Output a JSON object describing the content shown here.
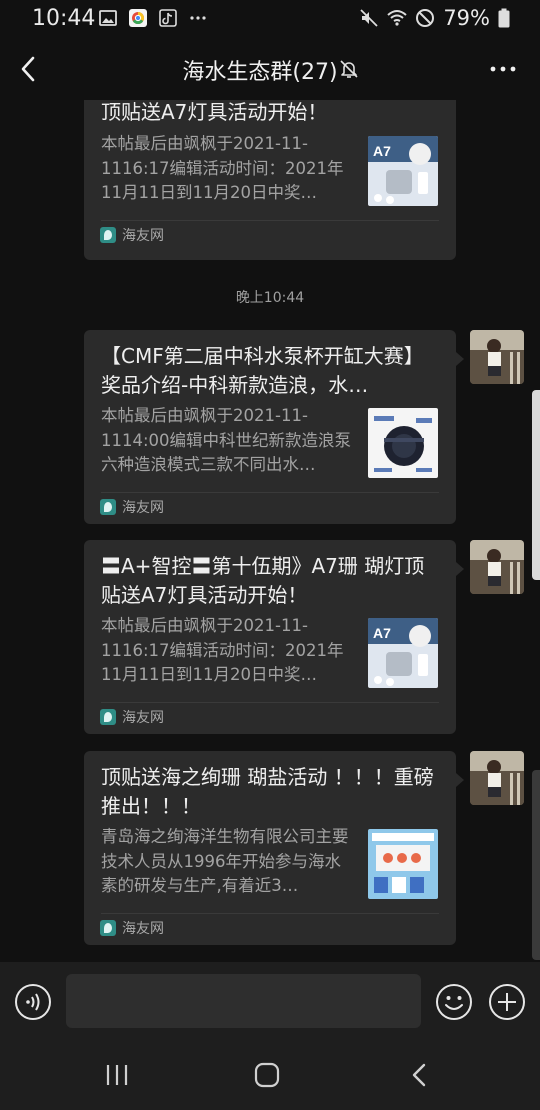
{
  "status_bar": {
    "time": "10:44",
    "battery": "79%",
    "left_icons": [
      "gallery-icon",
      "chrome-icon",
      "tiktok-icon",
      "more-dots-icon"
    ],
    "right_icons": [
      "mute-icon",
      "wifi-icon",
      "do-not-disturb-icon",
      "battery-icon"
    ]
  },
  "header": {
    "title": "海水生态群(27)",
    "mute_icon": "bell-off-icon"
  },
  "messages": [
    {
      "title": "顶贴送A7灯具活动开始！",
      "title_partial_top": true,
      "desc": "本帖最后由飒枫于2021-11-1116:17编辑活动时间：2021年11月11日到11月20日中奖…",
      "source": "海友网",
      "thumb_label": "A7"
    },
    {
      "timestamp": "晚上10:44"
    },
    {
      "title": "【CMF第二届中科水泵杯开缸大赛】奖品介绍-中科新款造浪，水…",
      "desc": "本帖最后由飒枫于2021-11-1114:00编辑中科世纪新款造浪泵六种造浪模式三款不同出水…",
      "source": "海友网"
    },
    {
      "title": "〓A+智控〓第十伍期》A7珊 瑚灯顶贴送A7灯具活动开始！",
      "desc": "本帖最后由飒枫于2021-11-1116:17编辑活动时间：2021年11月11日到11月20日中奖…",
      "source": "海友网",
      "thumb_label": "A7"
    },
    {
      "title": "顶贴送海之绚珊 瑚盐活动 ！！！重磅推出！！！",
      "desc": "青岛海之绚海洋生物有限公司主要技术人员从1996年开始参与海水素的研发与生产,有着近3…",
      "source": "海友网"
    }
  ],
  "input_bar": {
    "placeholder": "",
    "voice_icon": "voice-icon",
    "emoji_icon": "emoji-icon",
    "plus_icon": "plus-icon"
  },
  "system_nav": [
    "recent-apps-icon",
    "home-icon",
    "back-icon"
  ],
  "colors": {
    "background": "#111111",
    "card": "#2b2b2b",
    "text_primary": "#eeeeee",
    "text_secondary": "#a3a3a3",
    "source_logo": "#2f8d86"
  }
}
